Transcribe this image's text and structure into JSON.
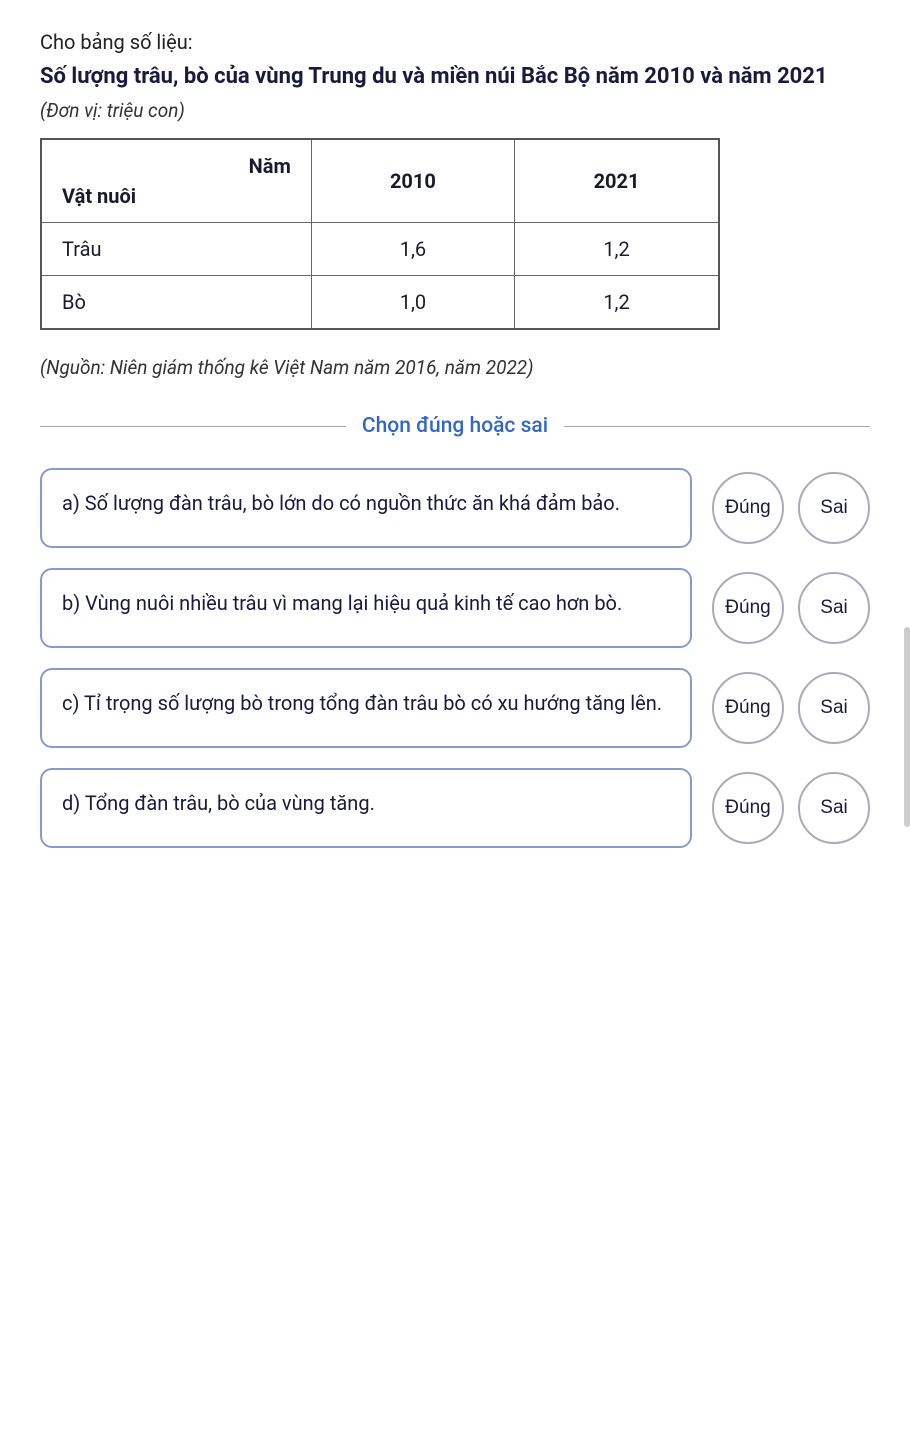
{
  "intro": {
    "label": "Cho bảng số liệu:"
  },
  "title": {
    "text": "Số lượng trâu, bò của vùng Trung du và miền núi Bắc Bộ năm 2010 và năm 2021"
  },
  "unit": {
    "text": "(Đơn vị: triệu con)"
  },
  "table": {
    "col_header_nam": "Năm",
    "col_header_vat_nuoi": "Vật nuôi",
    "col_2010": "2010",
    "col_2021": "2021",
    "rows": [
      {
        "animal": "Trâu",
        "val2010": "1,6",
        "val2021": "1,2"
      },
      {
        "animal": "Bò",
        "val2010": "1,0",
        "val2021": "1,2"
      }
    ]
  },
  "source": {
    "text": "(Nguồn: Niên giám thống kê Việt Nam năm 2016, năm 2022)"
  },
  "section": {
    "label": "Chọn đúng hoặc sai"
  },
  "questions": [
    {
      "id": "a",
      "text": "a) Số lượng đàn trâu, bò lớn do có nguồn thức ăn khá đảm bảo.",
      "btn_dung": "Đúng",
      "btn_sai": "Sai"
    },
    {
      "id": "b",
      "text": "b) Vùng nuôi nhiều trâu vì mang lại hiệu quả kinh tế cao hơn bò.",
      "btn_dung": "Đúng",
      "btn_sai": "Sai"
    },
    {
      "id": "c",
      "text": "c) Tỉ trọng số lượng bò trong tổng đàn trâu bò có xu hướng tăng lên.",
      "btn_dung": "Đúng",
      "btn_sai": "Sai"
    },
    {
      "id": "d",
      "text": "d) Tổng đàn trâu, bò của vùng tăng.",
      "btn_dung": "Đúng",
      "btn_sai": "Sai"
    }
  ]
}
